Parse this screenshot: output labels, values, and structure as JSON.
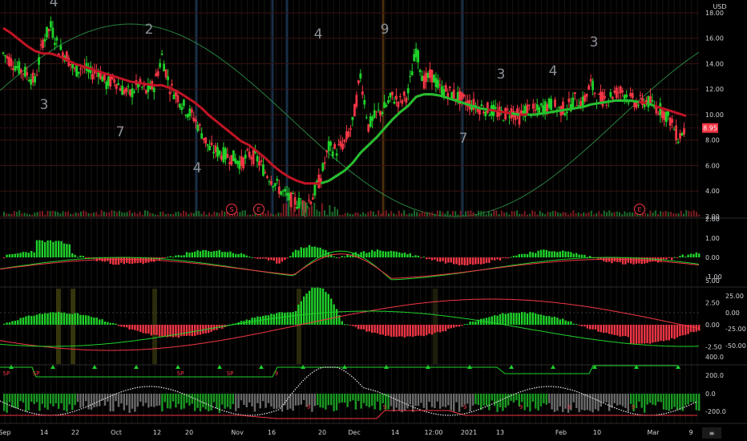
{
  "colors": {
    "background": "#000000",
    "up": "#1fd12a",
    "down": "#f23645",
    "ma_red": "#c01424",
    "ma_green": "#22c030",
    "thin_green": "#2fa050",
    "grid": "#1a1a1a",
    "axis_text": "#cfd2d6",
    "price_tag": "#f23645",
    "gray_bar": "#6b6b6b"
  },
  "price_axis": {
    "currency": "USD",
    "labels": [
      "18.00",
      "16.00",
      "14.00",
      "12.00",
      "10.00",
      "8.00",
      "6.00",
      "4.00",
      "2.00"
    ],
    "current_price": "8.95"
  },
  "pane2_axis": {
    "labels": [
      "2.00",
      "1.00",
      "0.00",
      "-1.00"
    ]
  },
  "pane3_axis": {
    "left_labels": [
      "5.00",
      "2.50",
      "0.00",
      "-2.50"
    ],
    "right_labels": [
      "25.00",
      "0.00",
      "-25.00",
      "-50.00"
    ]
  },
  "pane4_axis": {
    "labels": [
      "400.0",
      "200.0",
      "0.0",
      "-200.0"
    ]
  },
  "time_axis": {
    "labels": [
      "Sep",
      "14",
      "22",
      "Oct",
      "12",
      "20",
      "Nov",
      "16",
      "20",
      "Dec",
      "14",
      "12:00",
      "2021",
      "13",
      "Feb",
      "10",
      "Mar",
      "9"
    ]
  },
  "markers": {
    "counts": [
      {
        "text": "4"
      },
      {
        "text": "3"
      },
      {
        "text": "2"
      },
      {
        "text": "4"
      },
      {
        "text": "7"
      },
      {
        "text": "4"
      },
      {
        "text": "9"
      },
      {
        "text": "7"
      },
      {
        "text": "3"
      },
      {
        "text": "4"
      },
      {
        "text": "3"
      }
    ],
    "events": [
      {
        "text": "S"
      },
      {
        "text": "E"
      },
      {
        "text": "E"
      }
    ]
  },
  "signals": {
    "small_labels": [
      "SP",
      "SP",
      "SP",
      "SP",
      "9",
      "9",
      "9",
      "9",
      "9",
      "9",
      "9"
    ]
  },
  "chart_data": {
    "type": "line",
    "ylim": [
      2,
      18.5
    ],
    "series": [
      {
        "values": [
          14.8,
          14.2,
          13.6,
          13.2,
          12.6,
          15.8,
          16.9,
          15.2,
          14.6,
          13.4,
          13.8,
          13.2,
          13.5,
          12.4,
          12.8,
          12.0,
          11.6,
          12.4,
          11.8,
          12.3,
          14.6,
          12.2,
          11.4,
          10.4,
          9.8,
          8.6,
          7.3,
          7.1,
          6.8,
          6.6,
          6.2,
          6.9,
          6.5,
          5.5,
          4.8,
          4.0,
          3.4,
          3.1,
          2.9,
          3.6,
          5.1,
          7.4,
          7.2,
          7.8,
          9.3,
          13.1,
          9.1,
          10.0,
          10.5,
          11.4,
          11.0,
          11.7,
          15.1,
          12.6,
          13.1,
          12.0,
          11.8,
          11.5,
          11.1,
          10.8,
          10.6,
          10.4,
          10.2,
          10.0,
          10.3,
          9.8,
          10.5,
          10.2,
          10.6,
          10.8,
          10.4,
          10.5,
          11.2,
          10.9,
          12.4,
          11.2,
          11.3,
          11.7,
          11.9,
          11.2,
          10.9,
          11.1,
          10.7,
          10.3,
          9.6,
          8.2,
          8.95
        ]
      },
      {
        "values": [
          16.8,
          16.4,
          15.9,
          15.4,
          15.0,
          14.8,
          14.8,
          14.6,
          14.3,
          14.0,
          13.8,
          13.6,
          13.4,
          13.2,
          13.0,
          12.8,
          12.6,
          12.5,
          12.4,
          12.3,
          12.3,
          12.1,
          11.8,
          11.4,
          11.0,
          10.5,
          9.9,
          9.4,
          8.9,
          8.4,
          7.9,
          7.6,
          7.1,
          6.6,
          6.0,
          5.5,
          5.1,
          4.8,
          4.6,
          4.6,
          4.6,
          4.8,
          5.2,
          5.6,
          6.2,
          7.0,
          7.6,
          8.2,
          8.9,
          9.6,
          10.2,
          10.7,
          11.4,
          11.6,
          11.6,
          11.5,
          11.3,
          11.1,
          10.9,
          10.7,
          10.5,
          10.4,
          10.3,
          10.2,
          10.1,
          10.0,
          10.0,
          10.0,
          10.1,
          10.2,
          10.3,
          10.4,
          10.5,
          10.6,
          10.8,
          10.9,
          11.0,
          11.1,
          11.1,
          11.1,
          11.0,
          10.9,
          10.7,
          10.5,
          10.3,
          10.1,
          9.9
        ]
      }
    ]
  }
}
